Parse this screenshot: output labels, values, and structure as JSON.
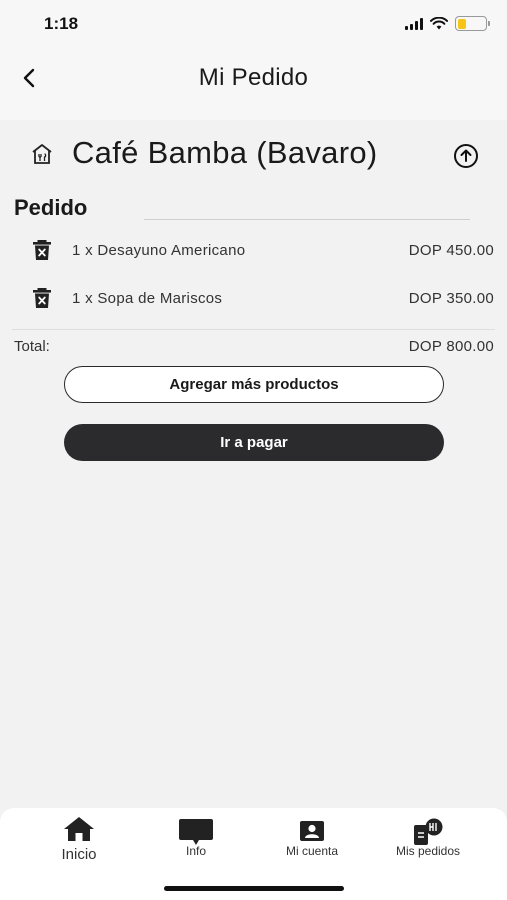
{
  "status_bar": {
    "time": "1:18",
    "battery_level": 0.3
  },
  "nav": {
    "title": "Mi Pedido",
    "back_icon": "chevron-left-icon"
  },
  "store": {
    "name": "Café Bamba (Bavaro)",
    "store_icon": "storefront-icon",
    "action_icon": "arrow-up-circle-icon"
  },
  "order": {
    "section_title": "Pedido",
    "items": [
      {
        "label": "1 x Desayuno Americano",
        "price": "DOP 450.00",
        "icon": "trash-icon"
      },
      {
        "label": "1 x Sopa de Mariscos",
        "price": "DOP 350.00",
        "icon": "trash-icon"
      }
    ],
    "total_label": "Total:",
    "total_value": "DOP 800.00"
  },
  "actions": {
    "add_more_label": "Agregar más productos",
    "checkout_label": "Ir a pagar"
  },
  "tabbar": {
    "items": [
      {
        "label": "Inicio",
        "icon": "home-icon"
      },
      {
        "label": "Info",
        "icon": "chat-icon"
      },
      {
        "label": "Mi cuenta",
        "icon": "account-icon"
      },
      {
        "label": "Mis pedidos",
        "icon": "orders-icon"
      }
    ]
  }
}
